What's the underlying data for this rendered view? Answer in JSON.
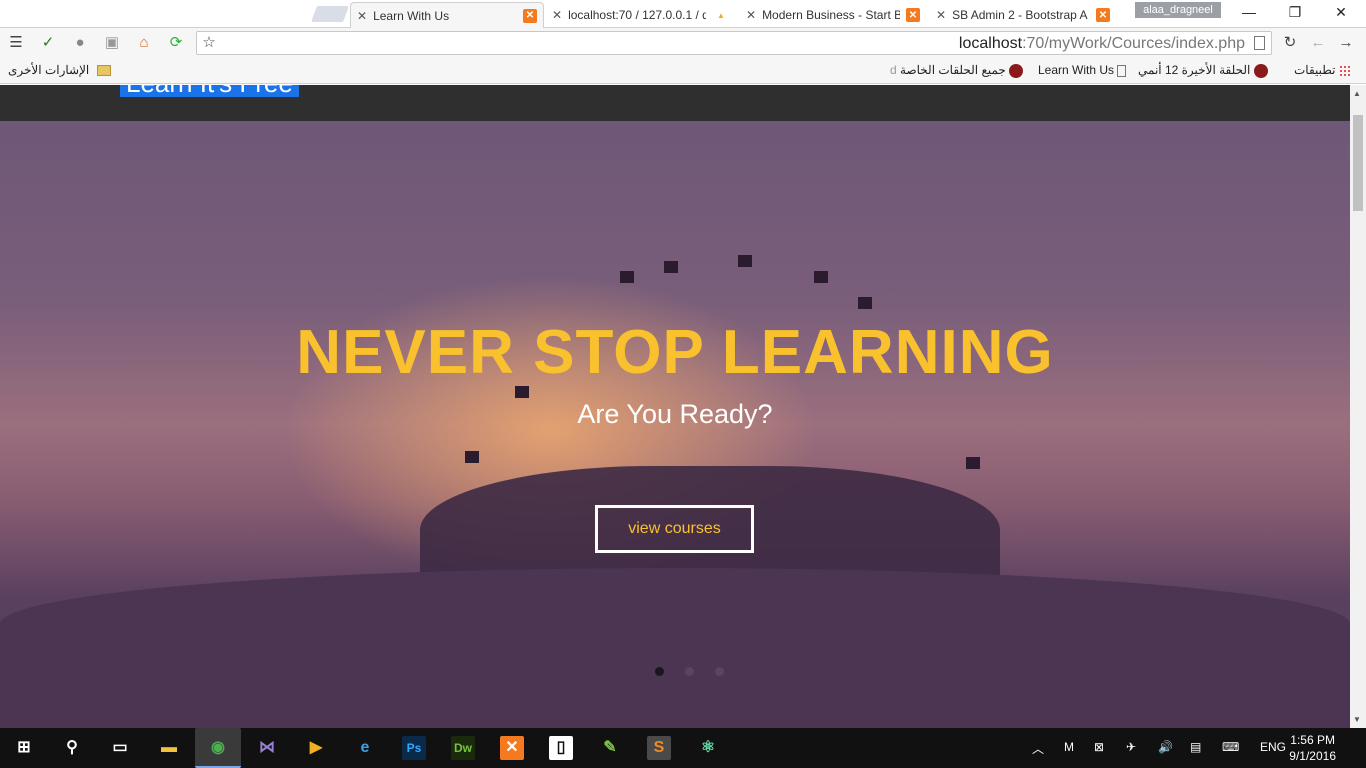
{
  "browser": {
    "tabs": [
      {
        "title": "Learn With Us",
        "active": true
      },
      {
        "title": "localhost:70 / 127.0.0.1 / d",
        "active": false
      },
      {
        "title": "Modern Business - Start B",
        "active": false
      },
      {
        "title": "SB Admin 2 - Bootstrap A",
        "active": false
      }
    ],
    "profile": "alaa_dragneel",
    "url_host": "localhost",
    "url_path": ":70/myWork/Cources/index.php",
    "window_controls": {
      "minimize": "—",
      "restore": "❐",
      "close": "✕"
    }
  },
  "bookmarks": {
    "other": "الإشارات الأخرى",
    "apps": "تطبيقات",
    "items": [
      "الحلقة الأخيرة 12 أنمي",
      "Learn With Us",
      "جميع الحلقات الخاصة"
    ]
  },
  "page": {
    "brand": "Learn It's Free",
    "headline": "NEVER STOP LEARNING",
    "subheadline": "Are You Ready?",
    "cta": "view courses",
    "carousel_slides": 3,
    "carousel_active": 0,
    "colors": {
      "accent": "#f9c12e",
      "navbar": "#2f2f2f"
    }
  },
  "taskbar": {
    "language": "ENG",
    "time": "1:56 PM",
    "date": "9/1/2016",
    "apps": [
      "file-explorer-icon",
      "chrome-icon",
      "visual-studio-icon",
      "media-player-icon",
      "ie-icon",
      "photoshop-icon",
      "dreamweaver-icon",
      "xampp-icon",
      "app-icon",
      "notepad-icon",
      "sublime-icon",
      "atom-icon"
    ],
    "app_labels": {
      "photoshop": "Ps",
      "dreamweaver": "Dw"
    }
  }
}
